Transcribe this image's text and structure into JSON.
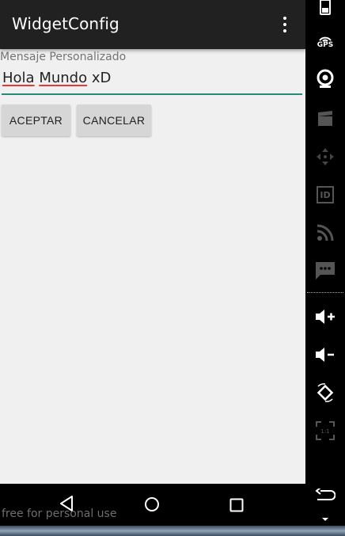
{
  "app": {
    "title": "WidgetConfig"
  },
  "form": {
    "label": "Mensaje Personalizado",
    "value_words": [
      "Hola",
      "Mundo",
      "xD"
    ]
  },
  "buttons": {
    "accept": "ACEPTAR",
    "cancel": "CANCELAR"
  },
  "watermark": "free for personal use",
  "side_tools": [
    "battery-icon",
    "gps-icon",
    "camera-icon",
    "clapperboard-icon",
    "dpad-icon",
    "id-icon",
    "rss-icon",
    "message-icon",
    "volume-up-icon",
    "volume-down-icon",
    "rotate-icon",
    "fullscreen-icon",
    "return-icon",
    "chevron-down-icon"
  ],
  "side_text": {
    "gps": "GPS",
    "id": "ID",
    "scale": "1:1"
  },
  "colors": {
    "accent": "#22897d",
    "app_bar": "#212121",
    "background": "#f0f0f0",
    "spell_underline": "#e53935"
  }
}
